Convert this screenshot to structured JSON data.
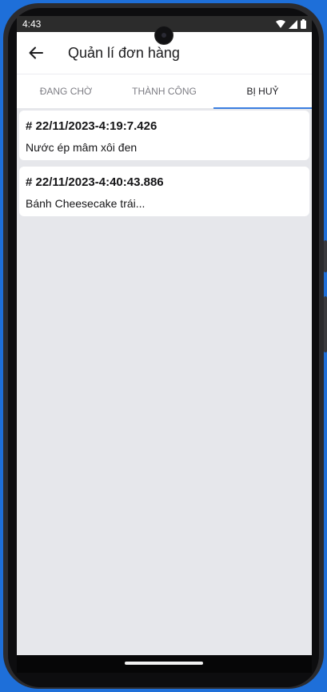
{
  "status_bar": {
    "time": "4:43",
    "icons": [
      "wifi-icon",
      "signal-icon",
      "battery-icon"
    ]
  },
  "app_bar": {
    "title": "Quản lí đơn hàng",
    "back_icon": "arrow-left-icon"
  },
  "tabs": [
    {
      "label": "ĐANG CHỜ",
      "active": false
    },
    {
      "label": "THÀNH CÔNG",
      "active": false
    },
    {
      "label": "BỊ HUỶ",
      "active": true
    }
  ],
  "orders": [
    {
      "id": "# 22/11/2023-4:19:7.426",
      "item": "Nước ép mâm xôi đen"
    },
    {
      "id": "# 22/11/2023-4:40:43.886",
      "item": "Bánh Cheesecake trái..."
    }
  ],
  "colors": {
    "accent": "#3b7ee0",
    "screen_bg": "#e6e7eb",
    "card_bg": "#ffffff",
    "status_bar_bg": "#2c2c2c"
  }
}
